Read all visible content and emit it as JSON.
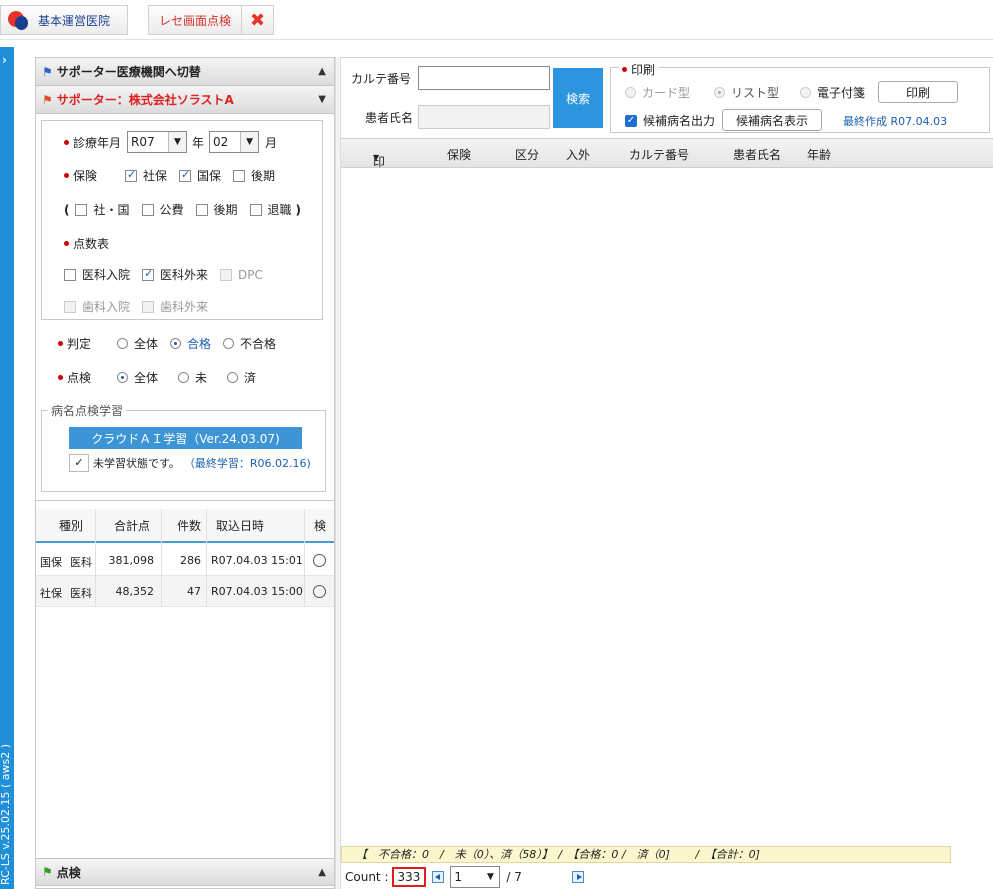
{
  "topbar": {
    "facility_button": "基本運営医院",
    "rese_button": "レセ画面点検"
  },
  "side_strip": {
    "version_text": "RC-LS v.25.02.15 ( aws2 )"
  },
  "left_panel": {
    "switch_header": "サポーター医療機関へ切替",
    "supporter_header": "サポーター：株式会社ソラストA",
    "shinryo_label": "診療年月",
    "year_value": "R07",
    "year_suffix": "年",
    "month_value": "02",
    "month_suffix": "月",
    "hoken_label": "保険",
    "shaho": "社保",
    "kokuho": "国保",
    "kouki": "後期",
    "paren_open": "(",
    "sha_koku": "社・国",
    "kouhi": "公費",
    "kouki2": "後期",
    "taishoku": "退職",
    "paren_close": ")",
    "tensu_label": "点数表",
    "ika_nyuin": "医科入院",
    "ika_gairai": "医科外来",
    "dpc": "DPC",
    "shika_nyuin": "歯科入院",
    "shika_gairai": "歯科外来",
    "hantei_label": "判定",
    "hantei_all": "全体",
    "hantei_pass": "合格",
    "hantei_fail": "不合格",
    "tenken_label": "点検",
    "tenken_all": "全体",
    "tenken_mi": "未",
    "tenken_zumi": "済",
    "learning_legend": "病名点検学習",
    "ai_button": "クラウドＡＩ学習（Ver.24.03.07)",
    "unlearned_text": "未学習状態です。",
    "last_learn_text": "（最終学習：R06.02.16)",
    "footer_header": "点検"
  },
  "summary_table": {
    "headers": [
      "種別",
      "合計点",
      "件数",
      "取込日時",
      "検"
    ],
    "rows": [
      {
        "type1": "国保",
        "type2": "医科",
        "total": "381,098",
        "count": "286",
        "date": "R07.04.03 15:01"
      },
      {
        "type1": "社保",
        "type2": "医科",
        "total": "48,352",
        "count": "47",
        "date": "R07.04.03 15:00"
      }
    ]
  },
  "search": {
    "karte_label": "カルテ番号",
    "karte_value": "",
    "patient_label": "患者氏名",
    "patient_value": "",
    "search_button": "検索"
  },
  "print": {
    "legend": "印刷",
    "card_type": "カード型",
    "list_type": "リスト型",
    "e_fusen": "電子付箋",
    "print_button": "印刷",
    "candidate_output": "候補病名出力",
    "candidate_show_button": "候補病名表示",
    "last_created": "最終作成 R07.04.03"
  },
  "main_table": {
    "headers": [
      "印刷",
      "保険",
      "区分",
      "入外",
      "カルテ番号",
      "患者氏名",
      "年齢"
    ]
  },
  "summary_bar": "【　不合格：0　/　未（0）、済（58）】　/　【合格：0 /　済（0]　　 /　【合計：0]",
  "footer": {
    "count_label": "Count :",
    "count_value": "333",
    "page_value": "1",
    "page_total": "/  7"
  }
}
